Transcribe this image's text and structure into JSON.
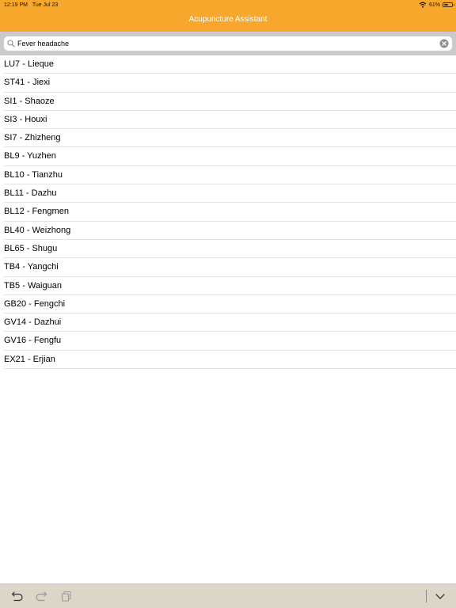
{
  "status": {
    "time": "12:19 PM",
    "date": "Tue Jul 23",
    "battery_text": "61%",
    "battery_level": 0.61
  },
  "nav": {
    "title": "Acupuncture Assistant"
  },
  "search": {
    "value": "Fever headache"
  },
  "results": [
    "LU7 - Lieque",
    "ST41 - Jiexi",
    "SI1 - Shaoze",
    "SI3 - Houxi",
    "SI7 - Zhizheng",
    "BL9 - Yuzhen",
    "BL10 - Tianzhu",
    "BL11 - Dazhu",
    "BL12 - Fengmen",
    "BL40 - Weizhong",
    "BL65 - Shugu",
    "TB4 - Yangchi",
    "TB5 - Waiguan",
    "GB20 - Fengchi",
    "GV14 - Dazhui",
    "GV16 - Fengfu",
    "EX21 - Erjian"
  ],
  "toolbar": {
    "icons": [
      "undo-icon",
      "redo-icon",
      "paste-icon",
      "chevron-down-icon"
    ]
  },
  "colors": {
    "header": "#f7a72c",
    "search_bar": "#c9c9ce",
    "toolbar": "#dcd6c9"
  }
}
